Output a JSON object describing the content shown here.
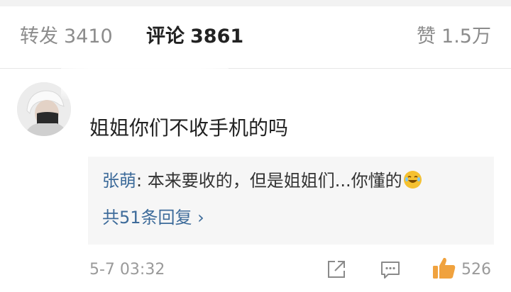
{
  "tabs": {
    "repost": {
      "label": "转发",
      "count": "3410"
    },
    "comments": {
      "label": "评论",
      "count": "3861"
    },
    "likes": {
      "label": "赞",
      "count": "1.5万"
    }
  },
  "comment": {
    "username": "",
    "text": "姐姐你们不收手机的吗",
    "time": "5-7 03:32",
    "like_count": "526"
  },
  "reply": {
    "author": "张萌",
    "text": ": 本来要收的，但是姐姐们...你懂的",
    "emoji": "laughing-emoji",
    "more_label": "共51条回复 ›"
  },
  "colors": {
    "link": "#3d6b9a",
    "like": "#f0a23e",
    "muted": "#9a9a9a"
  }
}
